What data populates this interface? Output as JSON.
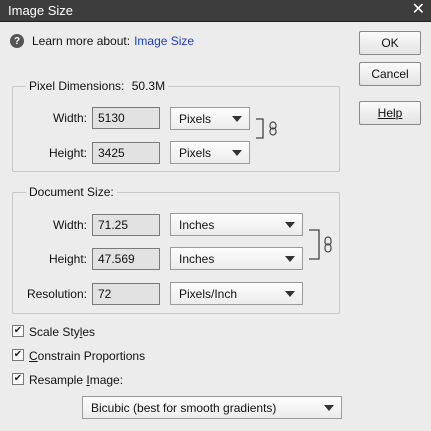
{
  "window": {
    "title": "Image Size",
    "close_glyph": "✕"
  },
  "learn": {
    "prefix": "Learn more about:",
    "link": "Image Size",
    "icon": "help-icon"
  },
  "buttons": {
    "ok": "OK",
    "cancel": "Cancel",
    "help": "Help"
  },
  "pixel_dimensions": {
    "legend": "Pixel Dimensions:",
    "size": "50.3M",
    "width_label": "Width:",
    "width_value": "5130",
    "width_unit": "Pixels",
    "height_label": "Height:",
    "height_value": "3425",
    "height_unit": "Pixels"
  },
  "document_size": {
    "legend": "Document Size:",
    "width_label": "Width:",
    "width_value": "71.25",
    "width_unit": "Inches",
    "height_label": "Height:",
    "height_value": "47.569",
    "height_unit": "Inches",
    "resolution_label": "Resolution:",
    "resolution_value": "72",
    "resolution_unit": "Pixels/Inch"
  },
  "options": {
    "scale_styles": {
      "label_pre": "Scale Sty",
      "label_u": "l",
      "label_post": "es",
      "checked": true
    },
    "constrain": {
      "label_pre": "",
      "label_u": "C",
      "label_post": "onstrain Proportions",
      "checked": true
    },
    "resample": {
      "label_pre": "Resample ",
      "label_u": "I",
      "label_post": "mage:",
      "checked": true
    },
    "resample_method": "Bicubic (best for smooth gradients)"
  }
}
